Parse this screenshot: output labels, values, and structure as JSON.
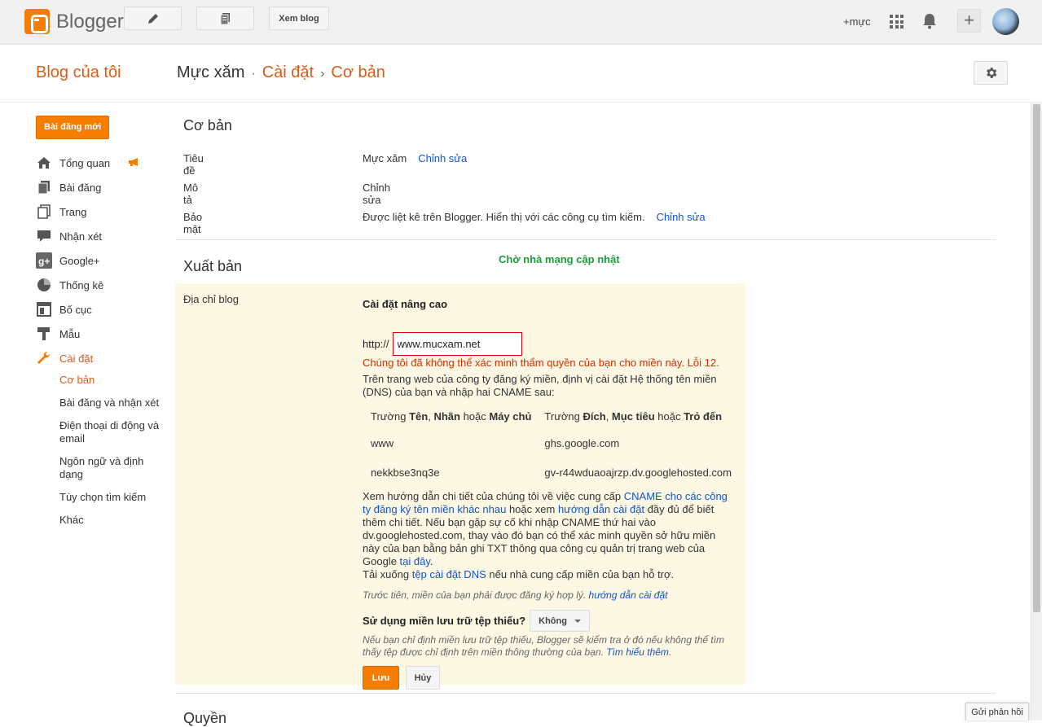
{
  "topbar": {
    "logo_text": "Blogger",
    "view_blog_label": "Xem blog",
    "user_name": "+mực",
    "plus_label": "+"
  },
  "header": {
    "my_blog": "Blog của tôi",
    "blog_name": "Mực xăm",
    "sep1": "·",
    "settings": "Cài đặt",
    "sep2": "›",
    "basic": "Cơ bản"
  },
  "sidebar": {
    "new_post": "Bài đăng mới",
    "items": [
      {
        "label": "Tổng quan",
        "icon": "home-icon"
      },
      {
        "label": "Bài đăng",
        "icon": "posts-icon"
      },
      {
        "label": "Trang",
        "icon": "page-icon"
      },
      {
        "label": "Nhận xét",
        "icon": "comment-icon"
      },
      {
        "label": "Google+",
        "icon": "google-plus-icon"
      },
      {
        "label": "Thống kê",
        "icon": "stats-icon"
      },
      {
        "label": "Bố cục",
        "icon": "layout-icon"
      },
      {
        "label": "Mẫu",
        "icon": "template-icon"
      },
      {
        "label": "Cài đặt",
        "icon": "wrench-icon"
      }
    ],
    "subitems": [
      "Cơ bản",
      "Bài đăng và nhận xét",
      "Điện thoại di động và email",
      "Ngôn ngữ và định dạng",
      "Tùy chọn tìm kiếm",
      "Khác"
    ]
  },
  "basic": {
    "title": "Cơ bản",
    "title_label": "Tiêu đề",
    "title_value": "Mực xăm",
    "edit": "Chỉnh sửa",
    "desc_label": "Mô tả",
    "privacy_label": "Bảo mật",
    "privacy_value": "Được liệt kê trên Blogger. Hiển thị với các công cụ tìm kiếm."
  },
  "publish": {
    "title": "Xuất bản",
    "pending_note": "Chờ nhà mạng cập nhật",
    "address_label": "Địa chỉ blog",
    "advanced_title": "Cài đặt nâng cao",
    "http_prefix": "http://",
    "domain_value": "www.mucxam.net",
    "error": "Chúng tôi đã không thể xác minh thẩm quyền của bạn cho miền này. Lỗi 12.",
    "instructions": "Trên trang web của công ty đăng ký miền, định vị cài đặt Hệ thống tên miền (DNS) của bạn và nhập hai CNAME sau:",
    "col1_pre": "Trường ",
    "col1_b1": "Tên",
    "col1_sep1": ", ",
    "col1_b2": "Nhãn",
    "col1_mid": " hoặc ",
    "col1_b3": "Máy chủ",
    "col2_pre": "Trường ",
    "col2_b1": "Đích",
    "col2_sep1": ", ",
    "col2_b2": "Mục tiêu",
    "col2_mid": " hoặc ",
    "col2_b3": "Trỏ đến",
    "rows": [
      {
        "name": "www",
        "target": "ghs.google.com"
      },
      {
        "name": "nekkbse3nq3e",
        "target": "gv-r44wduaoajrzp.dv.googlehosted.com"
      }
    ],
    "help_1": "Xem hướng dẫn chi tiết của chúng tôi về việc cung cấp ",
    "help_link1": "CNAME cho các công ty đăng ký tên miền khác nhau",
    "help_2": " hoặc xem ",
    "help_link2": "hướng dẫn cài đặt",
    "help_3": " đầy đủ để biết thêm chi tiết. Nếu bạn gặp sự cố khi nhập CNAME thứ hai vào dv.googlehosted.com, thay vào đó bạn có thể xác minh quyền sở hữu miền này của bạn bằng bản ghi TXT thông qua công cụ quản trị trang web của Google ",
    "help_link3": "tại đây",
    "help_4": ".",
    "download_1": "Tải xuống ",
    "download_link": "tệp cài đặt DNS",
    "download_2": " nếu nhà cung cấp miền của bạn hỗ trợ.",
    "registered_note": "Trước tiên, miền của bạn phải được đăng ký hợp lý. ",
    "registered_link": "hướng dẫn cài đặt",
    "missing_label": "Sử dụng miền lưu trữ tệp thiếu?",
    "missing_value": "Không",
    "missing_note": "Nếu bạn chỉ định miền lưu trữ tệp thiếu, Blogger sẽ kiểm tra ở đó nếu không thể tìm thấy tệp được chỉ định trên miền thông thường của bạn. ",
    "learn_more": "Tìm hiểu thêm",
    "learn_more_end": ".",
    "save": "Lưu",
    "cancel": "Hủy"
  },
  "permissions": {
    "title": "Quyền"
  },
  "feedback": "Gửi phản hồi",
  "colors": {
    "brand_orange": "#f57d00",
    "link_blue": "#1155cc",
    "error_red": "#dd2c00",
    "pending_green": "#1e9e3a",
    "panel_yellow": "#fdf8e4"
  }
}
